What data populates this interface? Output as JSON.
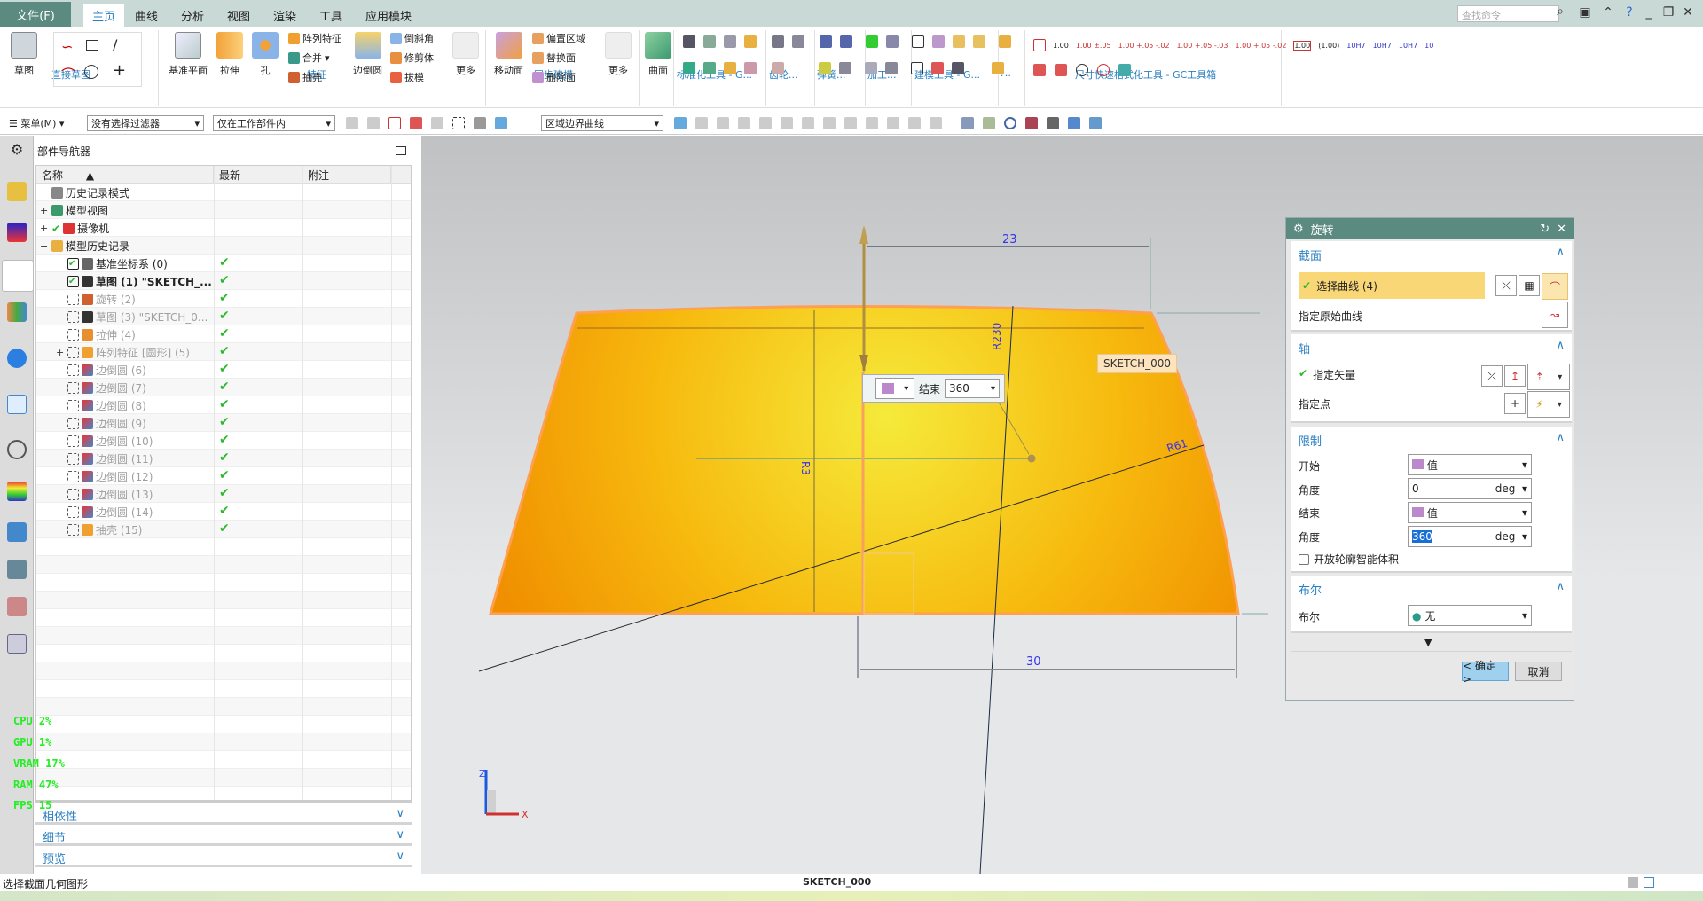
{
  "menubar": {
    "file": "文件(F)",
    "tabs": [
      "主页",
      "曲线",
      "分析",
      "视图",
      "渲染",
      "工具",
      "应用模块"
    ],
    "active_tab": "主页",
    "search_placeholder": "查找命令"
  },
  "ribbon": {
    "groups": [
      "直接草图",
      "特征",
      "同步建模",
      "标准化工具 - G...",
      "齿轮...",
      "弹簧...",
      "加工...",
      "建模工具 - G...",
      "?..",
      "尺寸快速格式化工具 - GC工具箱"
    ],
    "big_buttons": [
      "草图",
      "基准平面",
      "拉伸",
      "孔",
      "边倒圆",
      "更多",
      "移动面",
      "更多",
      "曲面"
    ],
    "feature_small": [
      "阵列特征",
      "合并",
      "抽壳",
      "倒斜角",
      "修剪体",
      "拔模"
    ],
    "sync_small": [
      "偏置区域",
      "替换面",
      "删除面"
    ],
    "dim_formats": [
      "1.00",
      "1.00 ±.05",
      "1.00 +.05 -.02",
      "1.00 +.05 -.03",
      "1.00 +.05 -.02",
      "1.00",
      "(1.00)",
      "10H7",
      "10H7",
      "10H7",
      "10"
    ]
  },
  "toolbar": {
    "menu": "菜单(M)",
    "filter": "没有选择过滤器",
    "scope": "仅在工作部件内",
    "curve_rule": "区域边界曲线"
  },
  "navigator": {
    "title": "部件导航器",
    "columns": [
      "名称",
      "最新",
      "附注"
    ],
    "rows": [
      {
        "name": "历史记录模式",
        "latest": "",
        "state": "normal",
        "indent": 0,
        "expander": ""
      },
      {
        "name": "模型视图",
        "latest": "",
        "state": "normal",
        "indent": 0,
        "expander": "+"
      },
      {
        "name": "摄像机",
        "latest": "",
        "state": "normal",
        "indent": 0,
        "expander": "+"
      },
      {
        "name": "模型历史记录",
        "latest": "",
        "state": "normal",
        "indent": 0,
        "expander": "−"
      },
      {
        "name": "基准坐标系 (0)",
        "latest": "✔",
        "state": "normal",
        "indent": 1,
        "expander": ""
      },
      {
        "name": "草图 (1) \"SKETCH_...",
        "latest": "✔",
        "state": "bold",
        "indent": 1,
        "expander": ""
      },
      {
        "name": "旋转 (2)",
        "latest": "✔",
        "state": "grey",
        "indent": 1,
        "expander": ""
      },
      {
        "name": "草图 (3) \"SKETCH_0...",
        "latest": "✔",
        "state": "grey",
        "indent": 1,
        "expander": ""
      },
      {
        "name": "拉伸 (4)",
        "latest": "✔",
        "state": "grey",
        "indent": 1,
        "expander": ""
      },
      {
        "name": "阵列特征 [圆形] (5)",
        "latest": "✔",
        "state": "grey",
        "indent": 1,
        "expander": "+"
      },
      {
        "name": "边倒圆 (6)",
        "latest": "✔",
        "state": "grey",
        "indent": 1,
        "expander": ""
      },
      {
        "name": "边倒圆 (7)",
        "latest": "✔",
        "state": "grey",
        "indent": 1,
        "expander": ""
      },
      {
        "name": "边倒圆 (8)",
        "latest": "✔",
        "state": "grey",
        "indent": 1,
        "expander": ""
      },
      {
        "name": "边倒圆 (9)",
        "latest": "✔",
        "state": "grey",
        "indent": 1,
        "expander": ""
      },
      {
        "name": "边倒圆 (10)",
        "latest": "✔",
        "state": "grey",
        "indent": 1,
        "expander": ""
      },
      {
        "name": "边倒圆 (11)",
        "latest": "✔",
        "state": "grey",
        "indent": 1,
        "expander": ""
      },
      {
        "name": "边倒圆 (12)",
        "latest": "✔",
        "state": "grey",
        "indent": 1,
        "expander": ""
      },
      {
        "name": "边倒圆 (13)",
        "latest": "✔",
        "state": "grey",
        "indent": 1,
        "expander": ""
      },
      {
        "name": "边倒圆 (14)",
        "latest": "✔",
        "state": "grey",
        "indent": 1,
        "expander": ""
      },
      {
        "name": "抽壳 (15)",
        "latest": "✔",
        "state": "grey",
        "indent": 1,
        "expander": ""
      }
    ],
    "panels": [
      "相依性",
      "细节",
      "预览"
    ]
  },
  "perf": {
    "cpu": "CPU   2%",
    "gpu": "GPU   1%",
    "vram": "VRAM  17%",
    "ram": "RAM  47%",
    "fps": "FPS   15"
  },
  "viewport": {
    "dims": {
      "d23": "23",
      "r230": "R230",
      "r3": "R3",
      "r61": "R61",
      "d30": "30"
    },
    "floating": {
      "label": "结束",
      "value": "360"
    },
    "tooltip": "SKETCH_000",
    "triad": {
      "z": "Z",
      "x": "X"
    }
  },
  "dialog": {
    "title": "旋转",
    "section": {
      "title": "截面",
      "select_curve": "选择曲线 (4)",
      "origin_curve": "指定原始曲线"
    },
    "axis": {
      "title": "轴",
      "vector": "指定矢量",
      "point": "指定点"
    },
    "limits": {
      "title": "限制",
      "start_label": "开始",
      "start_value": "值",
      "angle1_label": "角度",
      "angle1_value": "0",
      "end_label": "结束",
      "end_value": "值",
      "angle2_label": "角度",
      "angle2_value": "360",
      "unit": "deg",
      "checkbox": "开放轮廓智能体积",
      "checked": false
    },
    "boolean": {
      "title": "布尔",
      "label": "布尔",
      "value": "无"
    },
    "ok": "< 确定 >",
    "cancel": "取消"
  },
  "status": {
    "prompt": "选择截面几何图形",
    "center": "SKETCH_000"
  },
  "colors": {
    "accent": "#2a7fc0",
    "titlebar": "#5b8a80",
    "shape_center": "#f5ea3a",
    "shape_edge": "#f29200",
    "selection": "#fad776",
    "perf": "#22ee22"
  }
}
